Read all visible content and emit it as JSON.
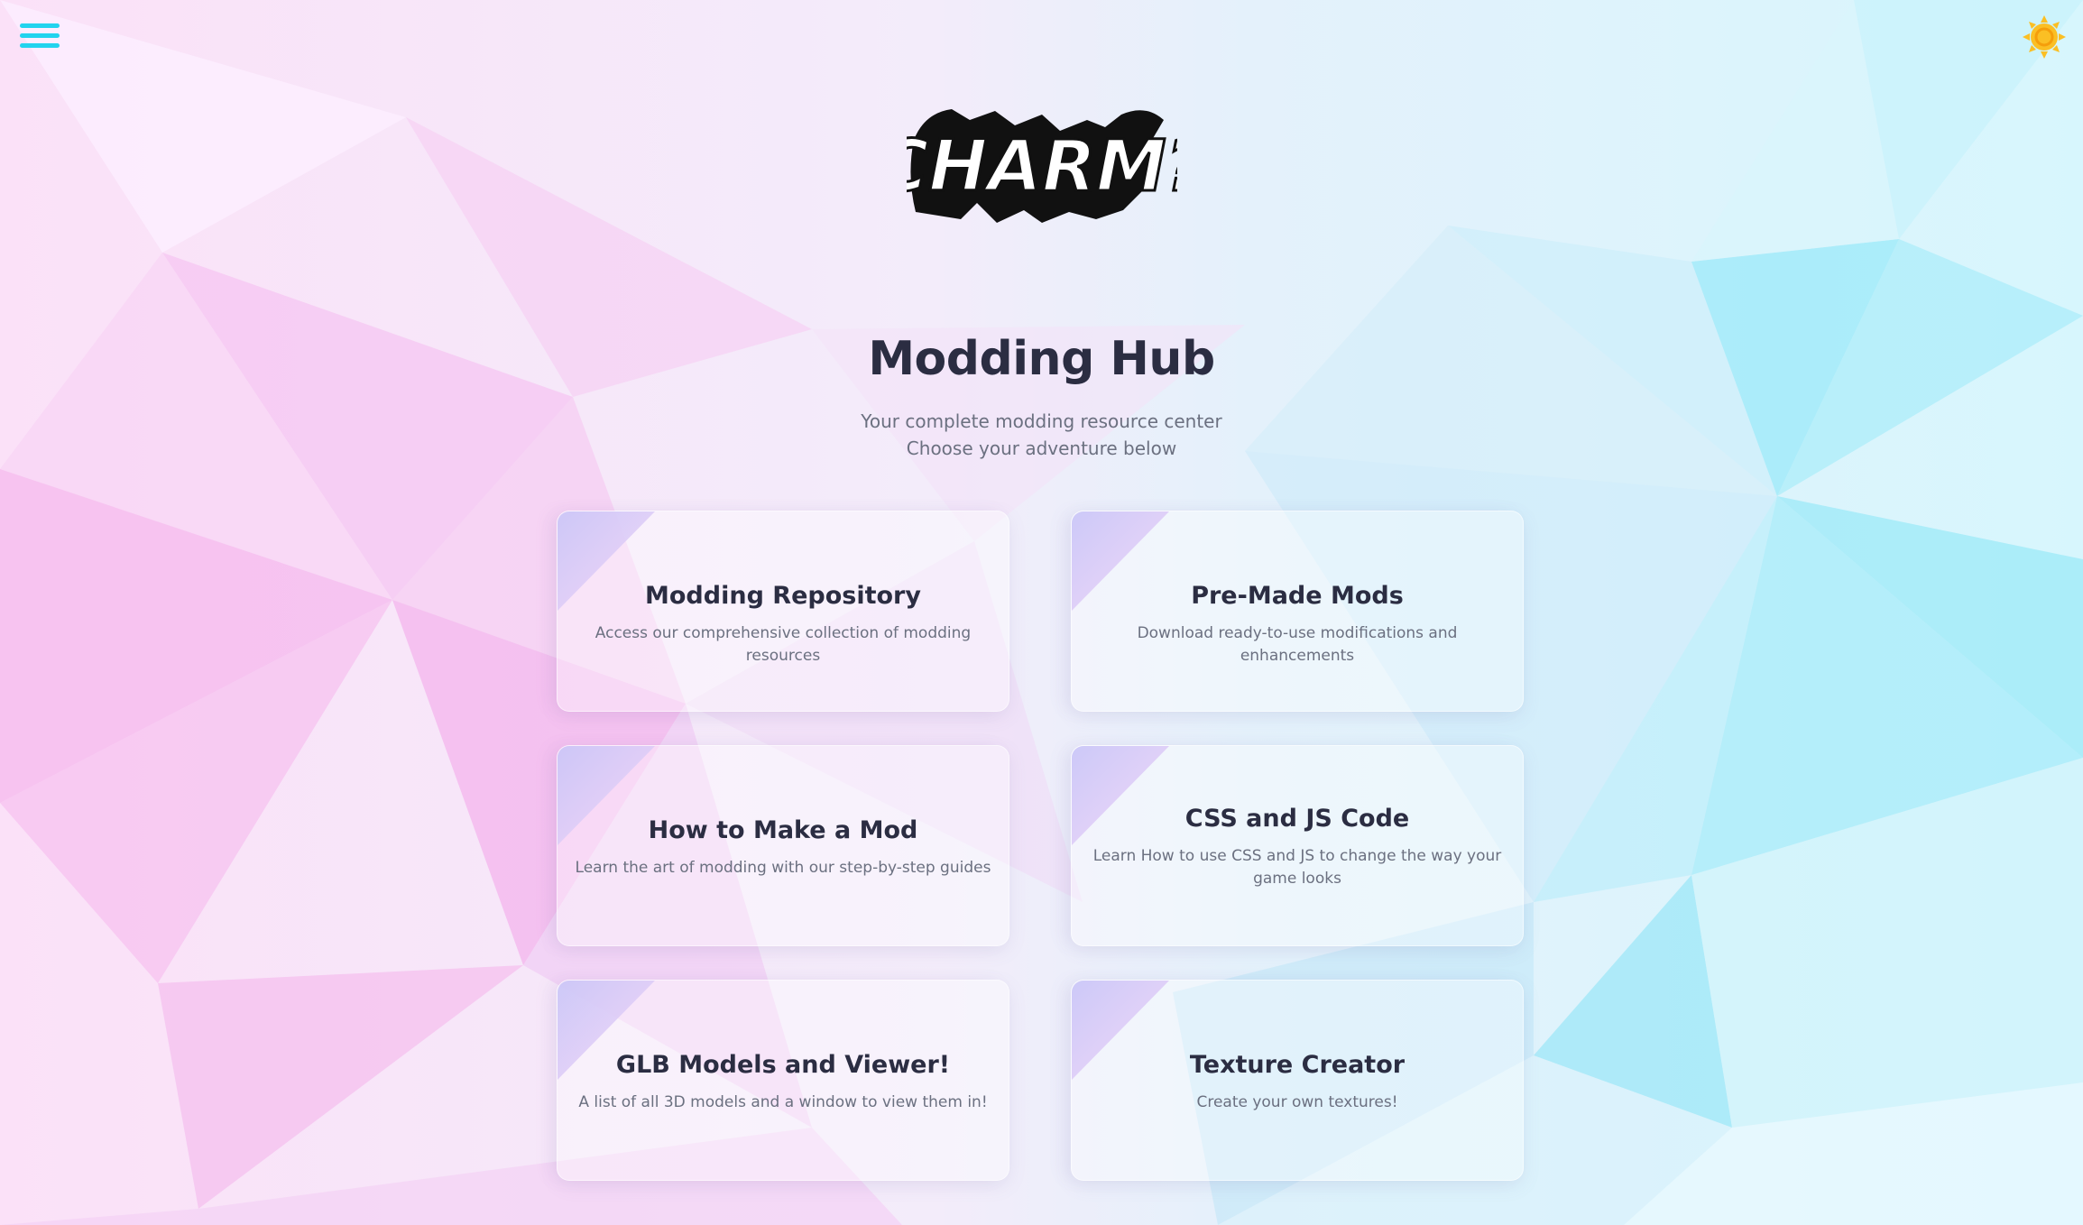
{
  "header": {
    "menu_icon": "hamburger-menu-icon",
    "theme_icon": "sun-icon",
    "logo_text": "CHARM?"
  },
  "hero": {
    "title": "Modding Hub",
    "subtitle_line1": "Your complete modding resource center",
    "subtitle_line2": "Choose your adventure below"
  },
  "cards": [
    {
      "title": "Modding Repository",
      "description": "Access our comprehensive collection of modding resources"
    },
    {
      "title": "Pre-Made Mods",
      "description": "Download ready-to-use modifications and enhancements"
    },
    {
      "title": "How to Make a Mod",
      "description": "Learn the art of modding with our step-by-step guides"
    },
    {
      "title": "CSS and JS Code",
      "description": "Learn How to use CSS and JS to change the way your game looks"
    },
    {
      "title": "GLB Models and Viewer!",
      "description": "A list of all 3D models and a window to view them in!"
    },
    {
      "title": "Texture Creator",
      "description": "Create your own textures!"
    }
  ],
  "colors": {
    "accent_cyan": "#22d3ee",
    "sun_yellow": "#fbbf24",
    "title_text": "#2b2d42",
    "muted_text": "#6b7080",
    "bg_pink": "#f9a8f0",
    "bg_cyan": "#7de8f8"
  }
}
